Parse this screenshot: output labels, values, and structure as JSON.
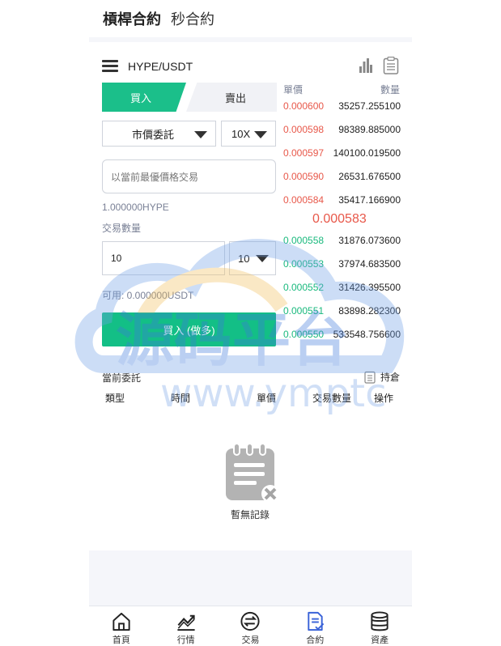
{
  "header": {
    "title_main": "槓桿合約",
    "title_sub": "秒合約"
  },
  "pair": {
    "name": "HYPE/USDT",
    "icons": [
      "menu-icon",
      "chart-icon",
      "document-icon"
    ]
  },
  "tabs": {
    "buy": "買入",
    "sell": "賣出"
  },
  "order_type": {
    "selected": "市價委託"
  },
  "leverage": {
    "selected": "10X"
  },
  "price_input": {
    "placeholder": "以當前最優價格交易"
  },
  "amount_hint": "1.000000HYPE",
  "qty_label": "交易數量",
  "qty_input": {
    "value": "10"
  },
  "qty_unit": {
    "selected": "10"
  },
  "available": "可用: 0.000000USDT",
  "submit_button": "買入 (做多)",
  "order_book": {
    "price_header": "單價",
    "qty_header": "數量",
    "asks": [
      {
        "price": "0.000600",
        "qty": "35257.255100"
      },
      {
        "price": "0.000598",
        "qty": "98389.885000"
      },
      {
        "price": "0.000597",
        "qty": "140100.019500"
      },
      {
        "price": "0.000590",
        "qty": "26531.676500"
      },
      {
        "price": "0.000584",
        "qty": "35417.166900"
      }
    ],
    "last_price": "0.000583",
    "bids": [
      {
        "price": "0.000558",
        "qty": "31876.073600"
      },
      {
        "price": "0.000553",
        "qty": "37974.683500"
      },
      {
        "price": "0.000552",
        "qty": "31426.395500"
      },
      {
        "price": "0.000551",
        "qty": "83898.282300"
      },
      {
        "price": "0.000550",
        "qty": "533548.756600"
      }
    ],
    "colors": {
      "ask": "#e8584a",
      "bid": "#19b97d"
    }
  },
  "orders": {
    "title": "當前委託",
    "hold_label": "持倉",
    "columns": [
      "類型",
      "時間",
      "單價",
      "交易數量",
      "操作"
    ],
    "empty_text": "暫無記錄"
  },
  "watermark": {
    "brand": "源码平台",
    "url": "www.ymptc"
  },
  "bottom_nav": [
    {
      "label": "首頁",
      "icon": "home-icon"
    },
    {
      "label": "行情",
      "icon": "trend-icon"
    },
    {
      "label": "交易",
      "icon": "exchange-icon"
    },
    {
      "label": "合約",
      "icon": "contract-icon"
    },
    {
      "label": "資產",
      "icon": "coins-icon"
    }
  ],
  "accent_color": "#13bf86"
}
